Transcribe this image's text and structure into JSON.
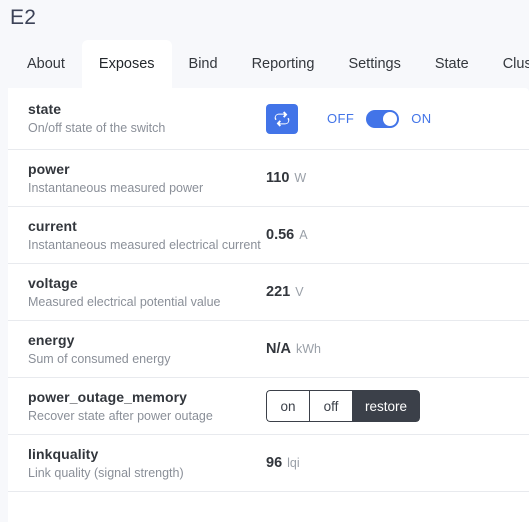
{
  "header": {
    "title": "E2"
  },
  "tabs": [
    {
      "label": "About",
      "active": false
    },
    {
      "label": "Exposes",
      "active": true
    },
    {
      "label": "Bind",
      "active": false
    },
    {
      "label": "Reporting",
      "active": false
    },
    {
      "label": "Settings",
      "active": false
    },
    {
      "label": "State",
      "active": false
    },
    {
      "label": "Clusters",
      "active": false
    }
  ],
  "colors": {
    "accent": "#4274e8",
    "page_bg": "#f7f8fb",
    "card_bg": "#ffffff",
    "divider": "#e8eaee",
    "dark": "#3b4049",
    "label": "#32363c",
    "muted": "#8a8f98",
    "unit": "#9aa0a8"
  },
  "rows": {
    "state": {
      "name": "state",
      "description": "On/off state of the switch",
      "refresh_icon": "sync-refresh-icon",
      "toggle": {
        "off_label": "OFF",
        "on_label": "ON",
        "checked": true
      }
    },
    "power": {
      "name": "power",
      "description": "Instantaneous measured power",
      "value": "110",
      "unit": "W"
    },
    "current": {
      "name": "current",
      "description": "Instantaneous measured electrical current",
      "value": "0.56",
      "unit": "A"
    },
    "voltage": {
      "name": "voltage",
      "description": "Measured electrical potential value",
      "value": "221",
      "unit": "V"
    },
    "energy": {
      "name": "energy",
      "description": "Sum of consumed energy",
      "value": "N/A",
      "unit": "kWh"
    },
    "power_outage_memory": {
      "name": "power_outage_memory",
      "description": "Recover state after power outage",
      "options": [
        {
          "label": "on",
          "selected": false
        },
        {
          "label": "off",
          "selected": false
        },
        {
          "label": "restore",
          "selected": true
        }
      ]
    },
    "linkquality": {
      "name": "linkquality",
      "description": "Link quality (signal strength)",
      "value": "96",
      "unit": "lqi"
    }
  }
}
